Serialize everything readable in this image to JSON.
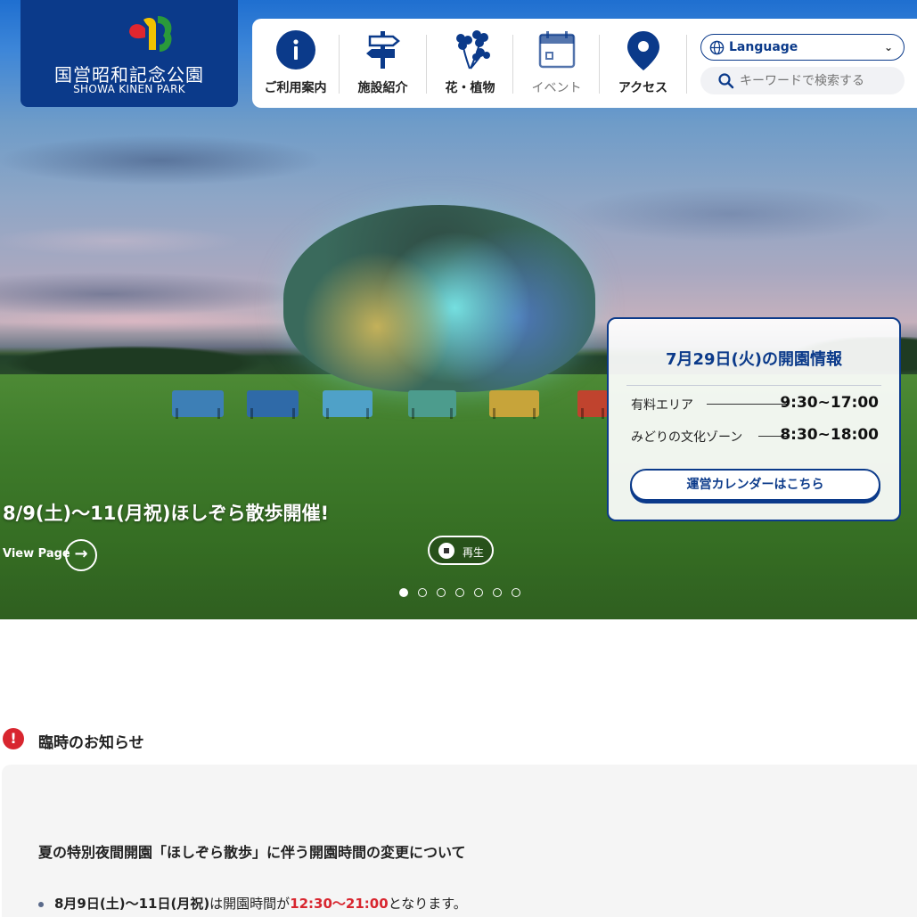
{
  "logo": {
    "jp": "国営昭和記念公園",
    "en": "SHOWA KINEN PARK"
  },
  "nav": {
    "items": [
      {
        "label": "ご利用案内",
        "icon": "info-icon"
      },
      {
        "label": "施設紹介",
        "icon": "signpost-icon"
      },
      {
        "label": "花・植物",
        "icon": "flower-icon"
      },
      {
        "label": "イベント",
        "icon": "calendar-icon"
      },
      {
        "label": "アクセス",
        "icon": "map-pin-icon"
      }
    ],
    "language_label": "Language",
    "search_placeholder": "キーワードで検索する"
  },
  "hero": {
    "caption": "8/9(土)～11(月祝)ほしぞら散歩開催!",
    "view_page": "View Page",
    "play_label": "再生",
    "slide_count": 7,
    "active_slide": 1
  },
  "info_card": {
    "title": "7月29日(火)の開園情報",
    "rows": [
      {
        "name": "有料エリア",
        "time": "9:30~17:00"
      },
      {
        "name": "みどりの文化ゾーン",
        "time": "8:30~18:00"
      }
    ],
    "button": "運営カレンダーはこちら"
  },
  "notice": {
    "heading": "臨時のお知らせ",
    "title": "夏の特別夜間開園「ほしぞら散歩」に伴う開園時間の変更について",
    "item_date": "8月9日(土)～11日(月祝)",
    "item_mid": "は開園時間が",
    "item_time": "12:30～21:00",
    "item_end": "となります。"
  },
  "colors": {
    "brand": "#0b3a8a",
    "alert": "#d8262f"
  }
}
